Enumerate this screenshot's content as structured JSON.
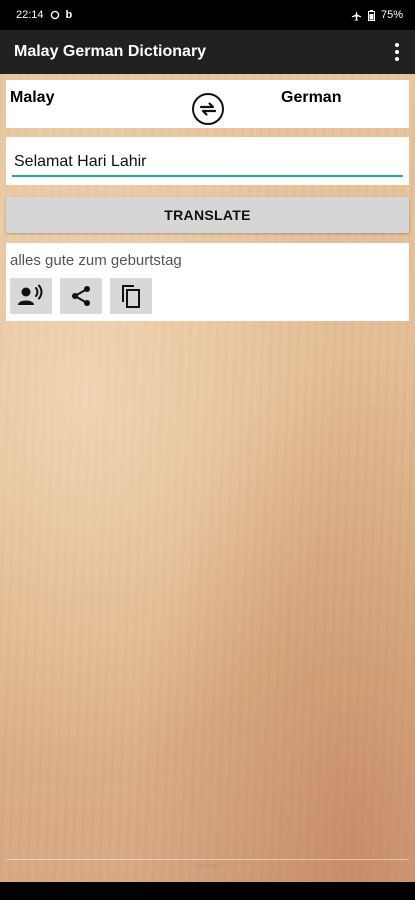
{
  "status": {
    "time": "22:14",
    "notification": "b",
    "battery": "75%"
  },
  "app": {
    "title": "Malay German Dictionary"
  },
  "languages": {
    "from": "Malay",
    "to": "German"
  },
  "input": {
    "value": "Selamat Hari Lahir"
  },
  "translate_label": "TRANSLATE",
  "result": {
    "text": "alles gute zum geburtstag"
  },
  "ad": {
    "label": "Anzeige"
  },
  "colors": {
    "app_bar": "#212121",
    "accent": "#26a69a",
    "button": "#d6d6d6"
  }
}
